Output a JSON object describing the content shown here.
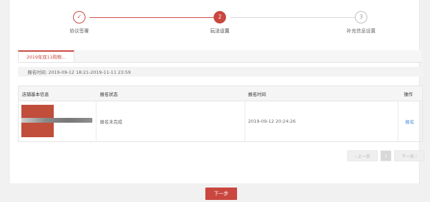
{
  "colors": {
    "accent": "#c9473f",
    "link": "#4a90d9"
  },
  "stepper": {
    "steps": [
      {
        "label": "协议签署",
        "marker": "✓",
        "state": "done"
      },
      {
        "label": "玩法设置",
        "marker": "2",
        "state": "active"
      },
      {
        "label": "补充信息设置",
        "marker": "3",
        "state": "todo"
      }
    ]
  },
  "tabs": [
    {
      "label": "2019年双11购物...",
      "active": true
    }
  ],
  "registration_time": "报名时间: 2019-09-12 18:21-2019-11-11 23:59",
  "table": {
    "columns": [
      "店铺基本信息",
      "报名状态",
      "报名时间",
      "操作"
    ],
    "rows": [
      {
        "status": "报名未完成",
        "time": "2019-09-12 20:24:26",
        "action": "报名"
      }
    ]
  },
  "pagination": {
    "prev": "‹ 上一页",
    "current": "1",
    "next": "下一页 ›"
  },
  "footer": {
    "next_step": "下一步"
  }
}
